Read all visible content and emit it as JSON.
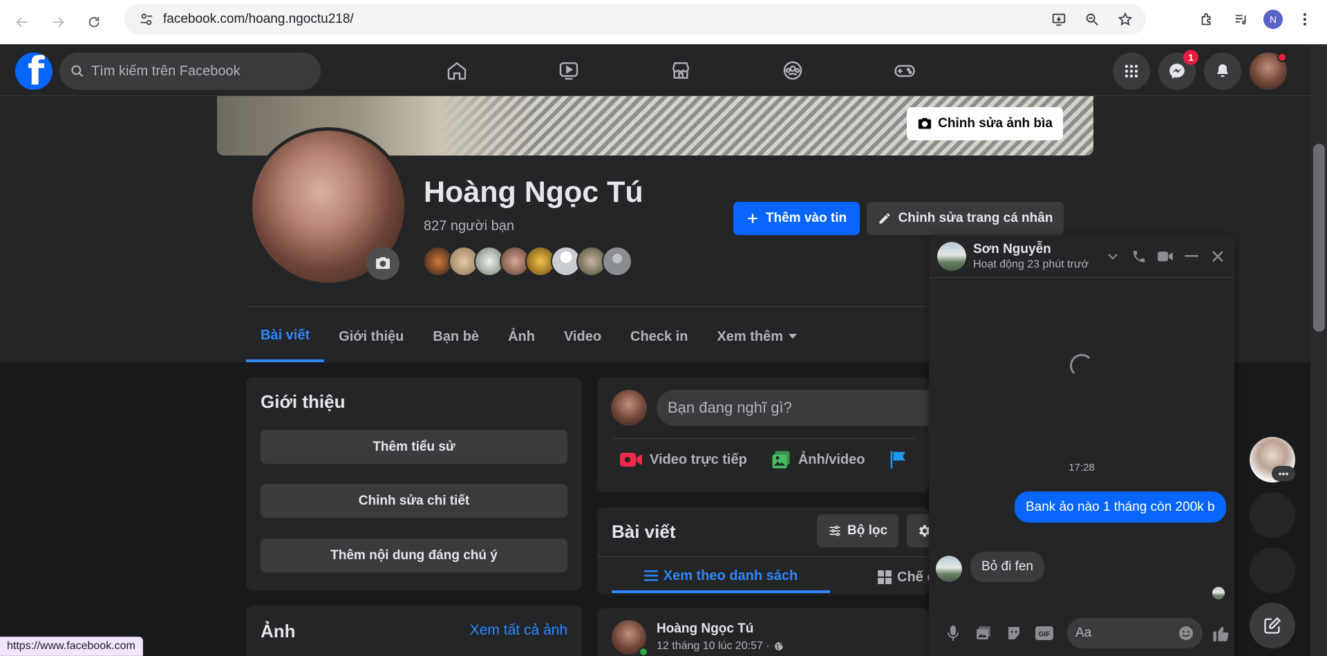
{
  "browser": {
    "url": "facebook.com/hoang.ngoctu218/",
    "profile_initial": "N",
    "status_url": "https://www.facebook.com"
  },
  "fb_nav": {
    "search_placeholder": "Tìm kiếm trên Facebook",
    "logo_letter": "f",
    "messenger_badge": "1",
    "center_icons": [
      "home-icon",
      "video-icon",
      "marketplace-icon",
      "groups-icon",
      "gaming-icon"
    ]
  },
  "cover": {
    "edit_label": "Chỉnh sửa ảnh bìa"
  },
  "profile": {
    "name": "Hoàng Ngọc Tú",
    "friends_count": "827 người bạn",
    "add_story_label": "Thêm vào tin",
    "edit_profile_label": "Chỉnh sửa trang cá nhân"
  },
  "tabs": [
    "Bài viết",
    "Giới thiệu",
    "Bạn bè",
    "Ảnh",
    "Video",
    "Check in",
    "Xem thêm"
  ],
  "intro": {
    "title": "Giới thiệu",
    "buttons": [
      "Thêm tiểu sử",
      "Chỉnh sửa chi tiết",
      "Thêm nội dung đáng chú ý"
    ]
  },
  "photos": {
    "title": "Ảnh",
    "see_all": "Xem tất cả ảnh"
  },
  "composer": {
    "placeholder": "Bạn đang nghĩ gì?",
    "actions": [
      "Video trực tiếp",
      "Ảnh/video"
    ]
  },
  "posts": {
    "title": "Bài viết",
    "filter_label": "Bộ lọc",
    "list_view_label": "Xem theo danh sách",
    "grid_view_label": "Chế đ"
  },
  "post": {
    "author": "Hoàng Ngọc Tú",
    "time": "12 tháng 10 lúc 20:57 ·"
  },
  "chat": {
    "contact_name": "Sơn Nguyễn",
    "status": "Hoạt động 23 phút trướ",
    "time": "17:28",
    "messages": [
      {
        "from": "me",
        "text": "Bank ảo nào 1 tháng còn 200k b"
      },
      {
        "from": "them",
        "text": "Bỏ đi fen"
      }
    ],
    "input_placeholder": "Aa"
  },
  "colors": {
    "accent": "#0866ff",
    "link": "#2d88ff",
    "surface": "#242526",
    "background": "#18191a"
  }
}
